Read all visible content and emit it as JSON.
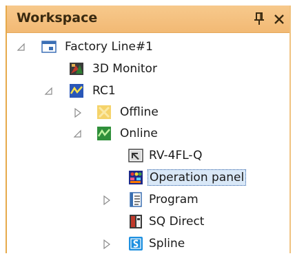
{
  "panel": {
    "title": "Workspace",
    "pin_glyph": "Ѩ",
    "close_glyph": "✕"
  },
  "tree": {
    "items": [
      {
        "label": "Factory Line#1",
        "icon": "factory-line-icon",
        "expander": "expanded"
      },
      {
        "label": "3D Monitor",
        "icon": "3d-monitor-icon",
        "expander": "none"
      },
      {
        "label": "RC1",
        "icon": "robot-controller-icon",
        "expander": "expanded"
      },
      {
        "label": "Offline",
        "icon": "offline-icon",
        "expander": "collapsed"
      },
      {
        "label": "Online",
        "icon": "online-icon",
        "expander": "expanded"
      },
      {
        "label": "RV-4FL-Q",
        "icon": "robot-model-icon",
        "expander": "none"
      },
      {
        "label": "Operation panel",
        "icon": "operation-panel-icon",
        "expander": "none",
        "selected": true
      },
      {
        "label": "Program",
        "icon": "program-icon",
        "expander": "collapsed"
      },
      {
        "label": "SQ Direct",
        "icon": "sq-direct-icon",
        "expander": "none"
      },
      {
        "label": "Spline",
        "icon": "spline-icon",
        "expander": "collapsed"
      }
    ]
  },
  "colors": {
    "header_bg": "#f5c283",
    "selection_bg": "#d9e8f7",
    "selection_border": "#2e5fa6"
  }
}
